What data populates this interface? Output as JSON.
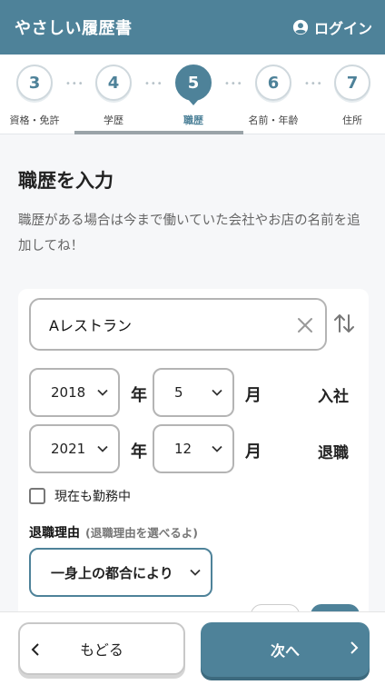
{
  "header": {
    "app_title": "やさしい履歴書",
    "login_label": "ログイン"
  },
  "steps": [
    {
      "number": "3",
      "label": "資格・免許",
      "active": false
    },
    {
      "number": "4",
      "label": "学歴",
      "active": false
    },
    {
      "number": "5",
      "label": "職歴",
      "active": true
    },
    {
      "number": "6",
      "label": "名前・年齢",
      "active": false
    },
    {
      "number": "7",
      "label": "住所",
      "active": false
    }
  ],
  "step_separator": "•••",
  "section": {
    "title": "職歴を入力",
    "description": "職歴がある場合は今まで働いていた会社やお店の名前を追加してね！"
  },
  "job": {
    "company_name": "Aレストラン",
    "start": {
      "year": "2018",
      "month": "5",
      "kind": "入社"
    },
    "end": {
      "year": "2021",
      "month": "12",
      "kind": "退職"
    },
    "year_unit": "年",
    "month_unit": "月",
    "currently_employed_label": "現在も勤務中",
    "reason_label": "退職理由",
    "reason_hint": "(退職理由を選べるよ)",
    "reason_value": "一身上の都合により"
  },
  "footer": {
    "back_label": "もどる",
    "next_label": "次へ"
  },
  "colors": {
    "accent": "#4e8299"
  }
}
